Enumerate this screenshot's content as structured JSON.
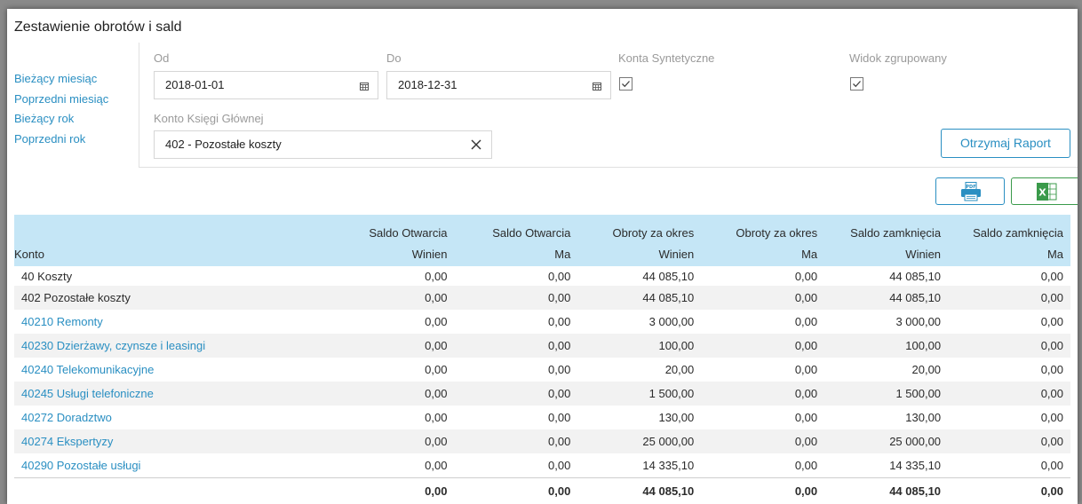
{
  "title": "Zestawienie obrotów i sald",
  "quick_links": [
    "Bieżący miesiąc",
    "Poprzedni miesiąc",
    "Bieżący rok",
    "Poprzedni rok"
  ],
  "filters": {
    "from_label": "Od",
    "from_value": "2018-01-01",
    "to_label": "Do",
    "to_value": "2018-12-31",
    "synthetic_label": "Konta Syntetyczne",
    "synthetic_checked": true,
    "grouped_label": "Widok zgrupowany",
    "grouped_checked": true,
    "account_label": "Konto Księgi Głównej",
    "account_value": "402 - Pozostałe koszty"
  },
  "buttons": {
    "report": "Otrzymaj Raport",
    "pdf_icon": "pdf-print-icon",
    "excel_icon": "excel-icon"
  },
  "table": {
    "header_top": [
      "",
      "Saldo Otwarcia",
      "Saldo Otwarcia",
      "Obroty za okres",
      "Obroty za okres",
      "Saldo zamknięcia",
      "Saldo zamknięcia"
    ],
    "header_bottom": [
      "Konto",
      "Winien",
      "Ma",
      "Winien",
      "Ma",
      "Winien",
      "Ma"
    ],
    "rows": [
      {
        "name": "40 Koszty",
        "link": false,
        "values": [
          "0,00",
          "0,00",
          "44 085,10",
          "0,00",
          "44 085,10",
          "0,00"
        ]
      },
      {
        "name": "402 Pozostałe koszty",
        "link": false,
        "values": [
          "0,00",
          "0,00",
          "44 085,10",
          "0,00",
          "44 085,10",
          "0,00"
        ]
      },
      {
        "name": "40210 Remonty",
        "link": true,
        "values": [
          "0,00",
          "0,00",
          "3 000,00",
          "0,00",
          "3 000,00",
          "0,00"
        ]
      },
      {
        "name": "40230 Dzierżawy, czynsze i leasingi",
        "link": true,
        "values": [
          "0,00",
          "0,00",
          "100,00",
          "0,00",
          "100,00",
          "0,00"
        ]
      },
      {
        "name": "40240 Telekomunikacyjne",
        "link": true,
        "values": [
          "0,00",
          "0,00",
          "20,00",
          "0,00",
          "20,00",
          "0,00"
        ]
      },
      {
        "name": "40245 Usługi telefoniczne",
        "link": true,
        "values": [
          "0,00",
          "0,00",
          "1 500,00",
          "0,00",
          "1 500,00",
          "0,00"
        ]
      },
      {
        "name": "40272 Doradztwo",
        "link": true,
        "values": [
          "0,00",
          "0,00",
          "130,00",
          "0,00",
          "130,00",
          "0,00"
        ]
      },
      {
        "name": "40274 Ekspertyzy",
        "link": true,
        "values": [
          "0,00",
          "0,00",
          "25 000,00",
          "0,00",
          "25 000,00",
          "0,00"
        ]
      },
      {
        "name": "40290 Pozostałe usługi",
        "link": true,
        "values": [
          "0,00",
          "0,00",
          "14 335,10",
          "0,00",
          "14 335,10",
          "0,00"
        ]
      }
    ],
    "totals": [
      "0,00",
      "0,00",
      "44 085,10",
      "0,00",
      "44 085,10",
      "0,00"
    ]
  },
  "colors": {
    "accent": "#2a8fc2",
    "header_bg": "#c5e6f6",
    "excel_green": "#3a9a4a"
  }
}
